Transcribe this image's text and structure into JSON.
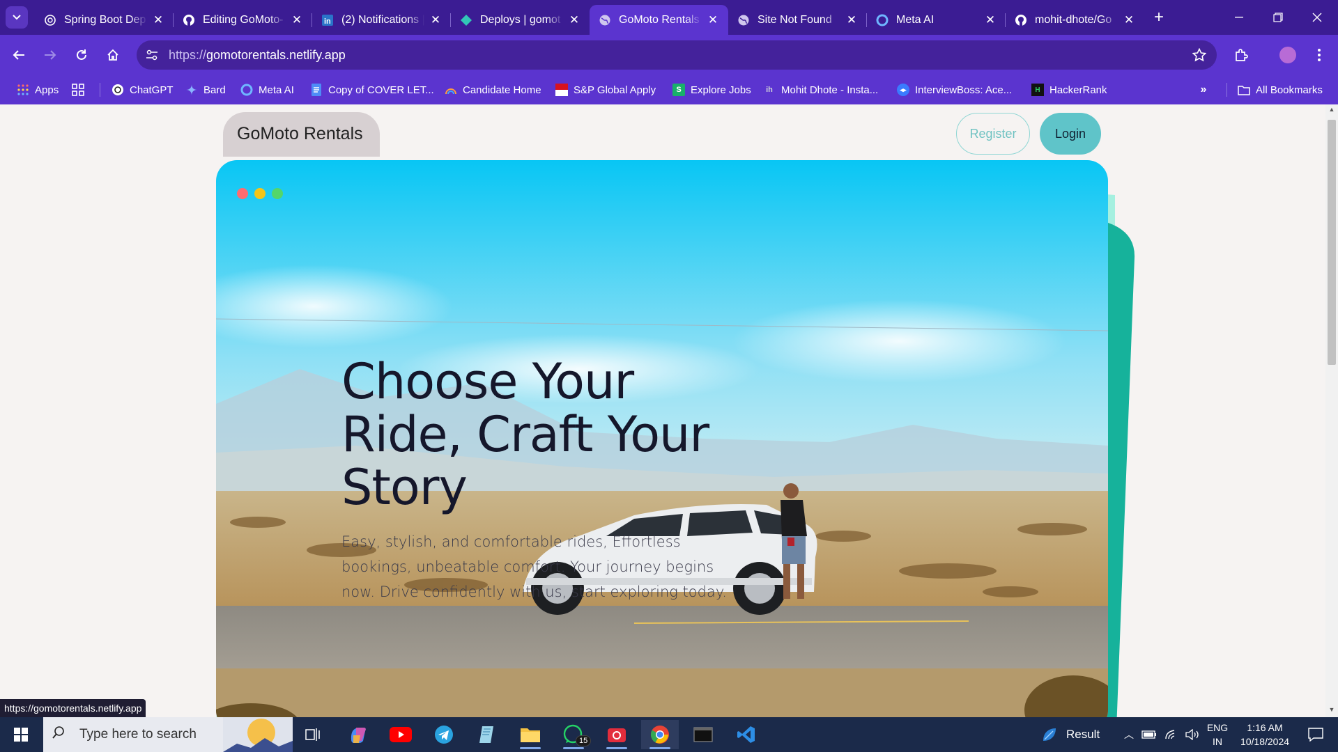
{
  "browser": {
    "tabs": [
      {
        "title": "Spring Boot Dep",
        "icon": "openai-icon"
      },
      {
        "title": "Editing GoMoto-",
        "icon": "github-icon"
      },
      {
        "title": "(2) Notifications |",
        "icon": "linkedin-icon"
      },
      {
        "title": "Deploys | gomot",
        "icon": "netlify-icon"
      },
      {
        "title": "GoMoto Rentals",
        "icon": "globe-icon",
        "active": true
      },
      {
        "title": "Site Not Found",
        "icon": "globe-icon"
      },
      {
        "title": "Meta AI",
        "icon": "meta-ai-icon"
      },
      {
        "title": "mohit-dhote/Go",
        "icon": "github-icon"
      }
    ],
    "url_scheme": "https://",
    "url_host": "gomotorentals.netlify.app",
    "bookmarks": [
      {
        "label": "Apps"
      },
      {
        "label": "ChatGPT"
      },
      {
        "label": "Bard"
      },
      {
        "label": "Meta AI"
      },
      {
        "label": "Copy of COVER LET..."
      },
      {
        "label": "Candidate Home"
      },
      {
        "label": "S&P Global Apply"
      },
      {
        "label": "Explore Jobs"
      },
      {
        "label": "Mohit Dhote - Insta..."
      },
      {
        "label": "InterviewBoss: Ace..."
      },
      {
        "label": "HackerRank"
      }
    ],
    "all_bookmarks_label": "All Bookmarks",
    "status_url": "https://gomotorentals.netlify.app",
    "theme": {
      "frame": "#3b1c93",
      "toolbar": "#5b34cf",
      "omnibox": "#44229b"
    }
  },
  "page": {
    "brand": "GoMoto Rentals",
    "register_label": "Register",
    "login_label": "Login",
    "hero_title": "Choose Your Ride, Craft Your Story",
    "hero_subtitle": "Easy, stylish, and comfortable rides, Effortless bookings, unbeatable comfort. Your journey begins now. Drive confidently with us, start exploring today.",
    "colors": {
      "accent": "#5fc4c9",
      "teal_shape": "#1bb5a0",
      "mint_shape": "#9ff0df"
    }
  },
  "taskbar": {
    "search_placeholder": "Type here to search",
    "weather_label": "Result",
    "whatsapp_badge": "15",
    "language_line1": "ENG",
    "language_line2": "IN",
    "time": "1:16 AM",
    "date": "10/18/2024"
  }
}
